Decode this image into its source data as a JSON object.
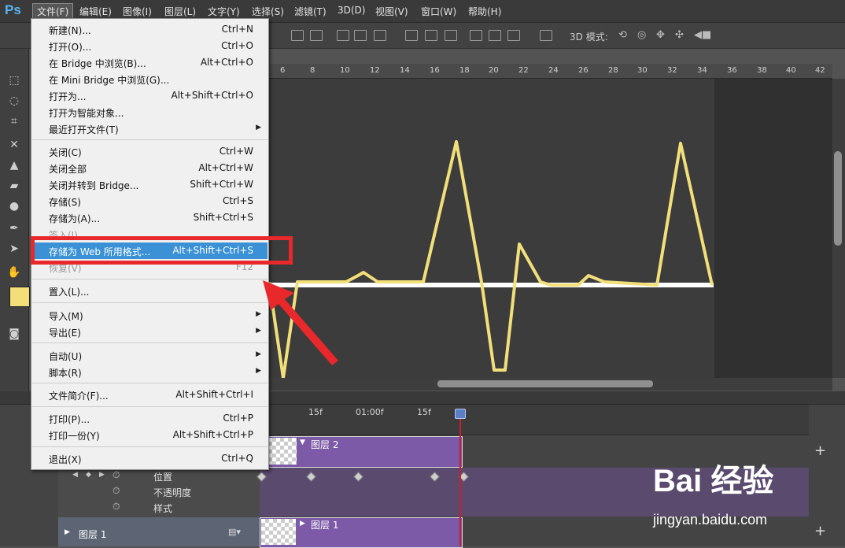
{
  "app": {
    "logo": "Ps"
  },
  "menubar": {
    "items": [
      "文件(F)",
      "编辑(E)",
      "图像(I)",
      "图层(L)",
      "文字(Y)",
      "选择(S)",
      "滤镜(T)",
      "3D(D)",
      "视图(V)",
      "窗口(W)",
      "帮助(H)"
    ]
  },
  "options_bar": {
    "mode_label": "3D 模式:"
  },
  "ruler": {
    "ticks": [
      "6",
      "8",
      "10",
      "12",
      "14",
      "16",
      "18",
      "20",
      "22",
      "24",
      "26",
      "28",
      "30",
      "32",
      "34",
      "36",
      "38",
      "40",
      "42"
    ]
  },
  "file_menu": {
    "items": [
      {
        "label": "新建(N)...",
        "shortcut": "Ctrl+N"
      },
      {
        "label": "打开(O)...",
        "shortcut": "Ctrl+O"
      },
      {
        "label": "在 Bridge 中浏览(B)...",
        "shortcut": "Alt+Ctrl+O"
      },
      {
        "label": "在 Mini Bridge 中浏览(G)...",
        "shortcut": ""
      },
      {
        "label": "打开为...",
        "shortcut": "Alt+Shift+Ctrl+O"
      },
      {
        "label": "打开为智能对象...",
        "shortcut": ""
      },
      {
        "label": "最近打开文件(T)",
        "shortcut": ""
      },
      {
        "label": "关闭(C)",
        "shortcut": "Ctrl+W"
      },
      {
        "label": "关闭全部",
        "shortcut": "Alt+Ctrl+W"
      },
      {
        "label": "关闭并转到 Bridge...",
        "shortcut": "Shift+Ctrl+W"
      },
      {
        "label": "存储(S)",
        "shortcut": "Ctrl+S"
      },
      {
        "label": "存储为(A)...",
        "shortcut": "Shift+Ctrl+S"
      },
      {
        "label": "签入(I)...",
        "shortcut": ""
      },
      {
        "label": "存储为 Web 所用格式...",
        "shortcut": "Alt+Shift+Ctrl+S"
      },
      {
        "label": "恢复(V)",
        "shortcut": "F12"
      },
      {
        "label": "置入(L)...",
        "shortcut": ""
      },
      {
        "label": "导入(M)",
        "shortcut": ""
      },
      {
        "label": "导出(E)",
        "shortcut": ""
      },
      {
        "label": "自动(U)",
        "shortcut": ""
      },
      {
        "label": "脚本(R)",
        "shortcut": ""
      },
      {
        "label": "文件简介(F)...",
        "shortcut": "Alt+Shift+Ctrl+I"
      },
      {
        "label": "打印(P)...",
        "shortcut": "Ctrl+P"
      },
      {
        "label": "打印一份(Y)",
        "shortcut": "Alt+Shift+Ctrl+P"
      },
      {
        "label": "退出(X)",
        "shortcut": "Ctrl+Q"
      }
    ]
  },
  "timeline": {
    "ruler_labels": [
      "15f",
      "01:00f",
      "15f"
    ],
    "layer2_name": "图层 2",
    "layer1_name": "图层 1",
    "properties": [
      "位置",
      "不透明度",
      "样式"
    ]
  },
  "watermark": {
    "brand": "Bai 经验",
    "url": "jingyan.baidu.com"
  },
  "colors": {
    "accent_highlight": "#3a91d6",
    "annotation_red": "#e8282a",
    "line_yellow": "#f2df7a",
    "clip_purple": "#7d5aa7"
  }
}
